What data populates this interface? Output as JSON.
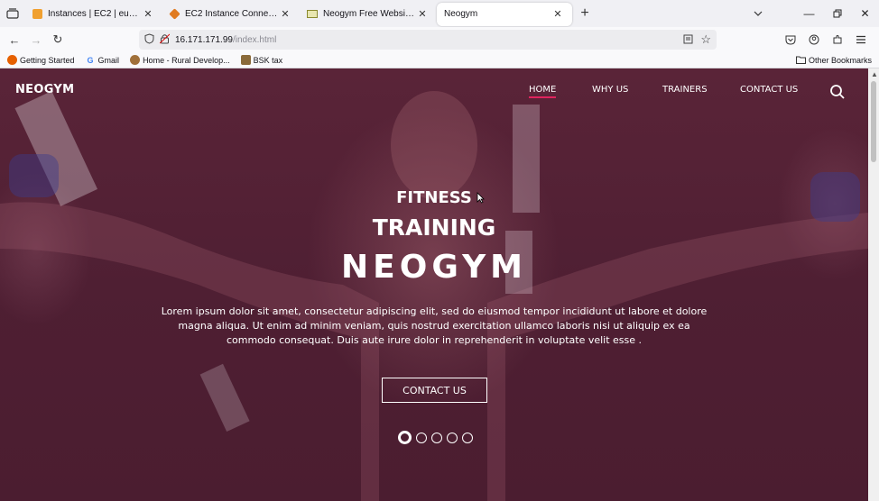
{
  "browser": {
    "tabs": [
      {
        "title": "Instances | EC2 | eu-north-1",
        "active": false
      },
      {
        "title": "EC2 Instance Connect | eu-north-1",
        "active": false
      },
      {
        "title": "Neogym Free Website Template",
        "active": false
      },
      {
        "title": "Neogym",
        "active": true
      }
    ],
    "url_host": "16.171.171.99",
    "url_path": "/index.html",
    "bookmarks": [
      "Getting Started",
      "Gmail",
      "Home - Rural Develop...",
      "BSK tax"
    ],
    "other_bookmarks": "Other Bookmarks"
  },
  "site": {
    "brand": "NEOGYM",
    "menu": [
      {
        "label": "HOME",
        "active": true
      },
      {
        "label": "WHY US",
        "active": false
      },
      {
        "label": "TRAINERS",
        "active": false
      },
      {
        "label": "CONTACT US",
        "active": false
      }
    ],
    "hero": {
      "line1": "FITNESS",
      "line2": "TRAINING",
      "line3": "NEOGYM",
      "text": "Lorem ipsum dolor sit amet, consectetur adipiscing elit, sed do eiusmod tempor incididunt ut labore et dolore magna aliqua. Ut enim ad minim veniam, quis nostrud exercitation ullamco laboris nisi ut aliquip ex ea commodo consequat. Duis aute irure dolor in reprehenderit in voluptate velit esse .",
      "cta": "CONTACT US"
    },
    "carousel": {
      "slides": 5,
      "active_index": 0
    }
  },
  "colors": {
    "accent": "#e0245e",
    "overlay": "#4f1f33"
  }
}
